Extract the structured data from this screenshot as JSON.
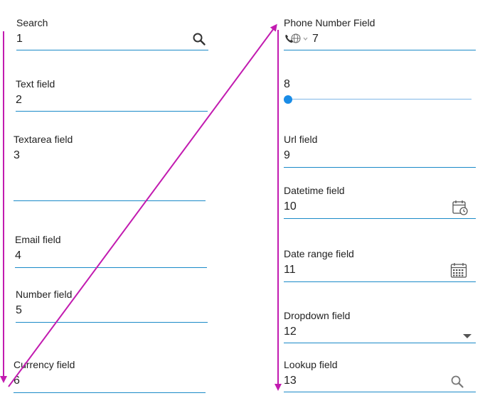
{
  "form": {
    "search": {
      "label": "Search",
      "value": "1",
      "icon": "search-icon"
    },
    "text": {
      "label": "Text field",
      "value": "2"
    },
    "textarea": {
      "label": "Textarea field",
      "value": "3"
    },
    "email": {
      "label": "Email field",
      "value": "4"
    },
    "number": {
      "label": "Number field",
      "value": "5"
    },
    "currency": {
      "label": "Currency field",
      "value": "6"
    },
    "phone": {
      "label": "Phone Number Field",
      "value": "7",
      "icon": "phone-globe-icon"
    },
    "slider": {
      "value": "8",
      "level": 0
    },
    "url": {
      "label": "Url field",
      "value": "9"
    },
    "datetime": {
      "label": "Datetime field",
      "value": "10",
      "icon": "calendar-clock-icon"
    },
    "daterange": {
      "label": "Date range field",
      "value": "11",
      "icon": "calendar-icon"
    },
    "dropdown": {
      "label": "Dropdown field",
      "value": "12",
      "icon": "caret-down-icon"
    },
    "lookup": {
      "label": "Lookup field",
      "value": "13",
      "icon": "search-icon"
    }
  },
  "colors": {
    "underline": "#1a8ac8",
    "arrow": "#c21bb0",
    "slider_thumb": "#1a8ce6"
  }
}
